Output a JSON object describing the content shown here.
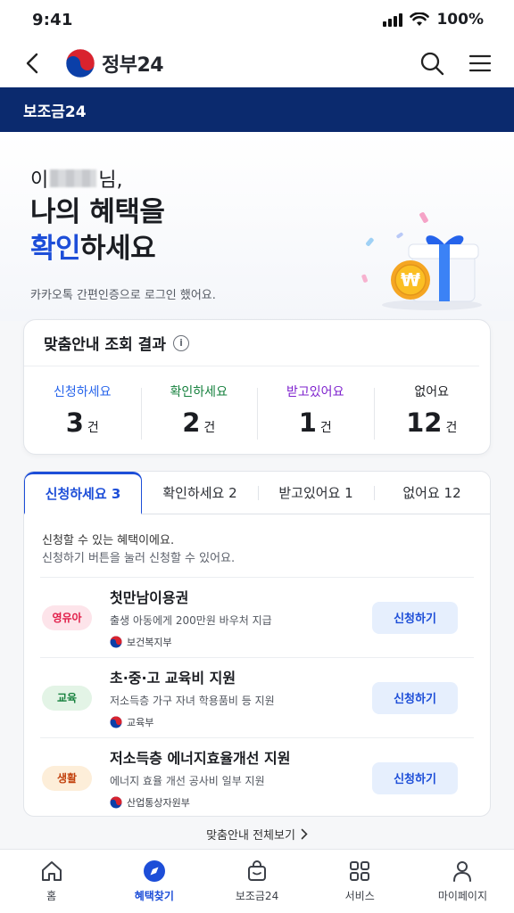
{
  "status": {
    "time": "9:41",
    "battery": "100%"
  },
  "header": {
    "logo_text": "정부24"
  },
  "banner": {
    "title": "보조금24"
  },
  "hero": {
    "greeting_prefix": "이",
    "greeting_suffix": "님,",
    "title_line1": "나의 혜택을",
    "title_accent": "확인",
    "title_line2_rest": "하세요",
    "subtitle": "카카오톡 간편인증으로 로그인 했어요."
  },
  "result": {
    "title": "맞춤안내 조회 결과",
    "info_icon": "i",
    "stats": [
      {
        "label": "신청하세요",
        "count": "3",
        "unit": "건",
        "color": "#2563eb"
      },
      {
        "label": "확인하세요",
        "count": "2",
        "unit": "건",
        "color": "#15803d"
      },
      {
        "label": "받고있어요",
        "count": "1",
        "unit": "건",
        "color": "#7e22ce"
      },
      {
        "label": "없어요",
        "count": "12",
        "unit": "건",
        "color": "#1b1d22"
      }
    ]
  },
  "tabs": [
    {
      "label": "신청하세요 3",
      "active": true
    },
    {
      "label": "확인하세요 2",
      "active": false
    },
    {
      "label": "받고있어요 1",
      "active": false
    },
    {
      "label": "없어요 12",
      "active": false
    }
  ],
  "list": {
    "desc_main": "신청할 수 있는 혜택이에요.",
    "desc_sub": "신청하기 버튼을 눌러 신청할 수 있어요.",
    "items": [
      {
        "badge": "영유아",
        "badge_color": "#e11d48",
        "badge_bg": "#fde4ea",
        "title": "첫만남이용권",
        "desc": "출생 아동에게 200만원 바우처 지급",
        "org": "보건복지부",
        "button": "신청하기"
      },
      {
        "badge": "교육",
        "badge_color": "#15803d",
        "badge_bg": "#e3f4e6",
        "title": "초·중·고 교육비 지원",
        "desc": "저소득층 가구 자녀 학용품비 등 지원",
        "org": "교육부",
        "button": "신청하기"
      },
      {
        "badge": "생활",
        "badge_color": "#c2410c",
        "badge_bg": "#fdeed9",
        "title": "저소득층 에너지효율개선 지원",
        "desc": "에너지 효율 개선 공사비 일부 지원",
        "org": "산업통상자원부",
        "button": "신청하기"
      }
    ]
  },
  "view_all": {
    "label": "맞춤안내 전체보기"
  },
  "nav": [
    {
      "label": "홈",
      "icon": "home-icon",
      "active": false
    },
    {
      "label": "혜택찾기",
      "icon": "compass-icon",
      "active": true
    },
    {
      "label": "보조금24",
      "icon": "bag-icon",
      "active": false
    },
    {
      "label": "서비스",
      "icon": "grid-icon",
      "active": false
    },
    {
      "label": "마이페이지",
      "icon": "person-icon",
      "active": false
    }
  ]
}
